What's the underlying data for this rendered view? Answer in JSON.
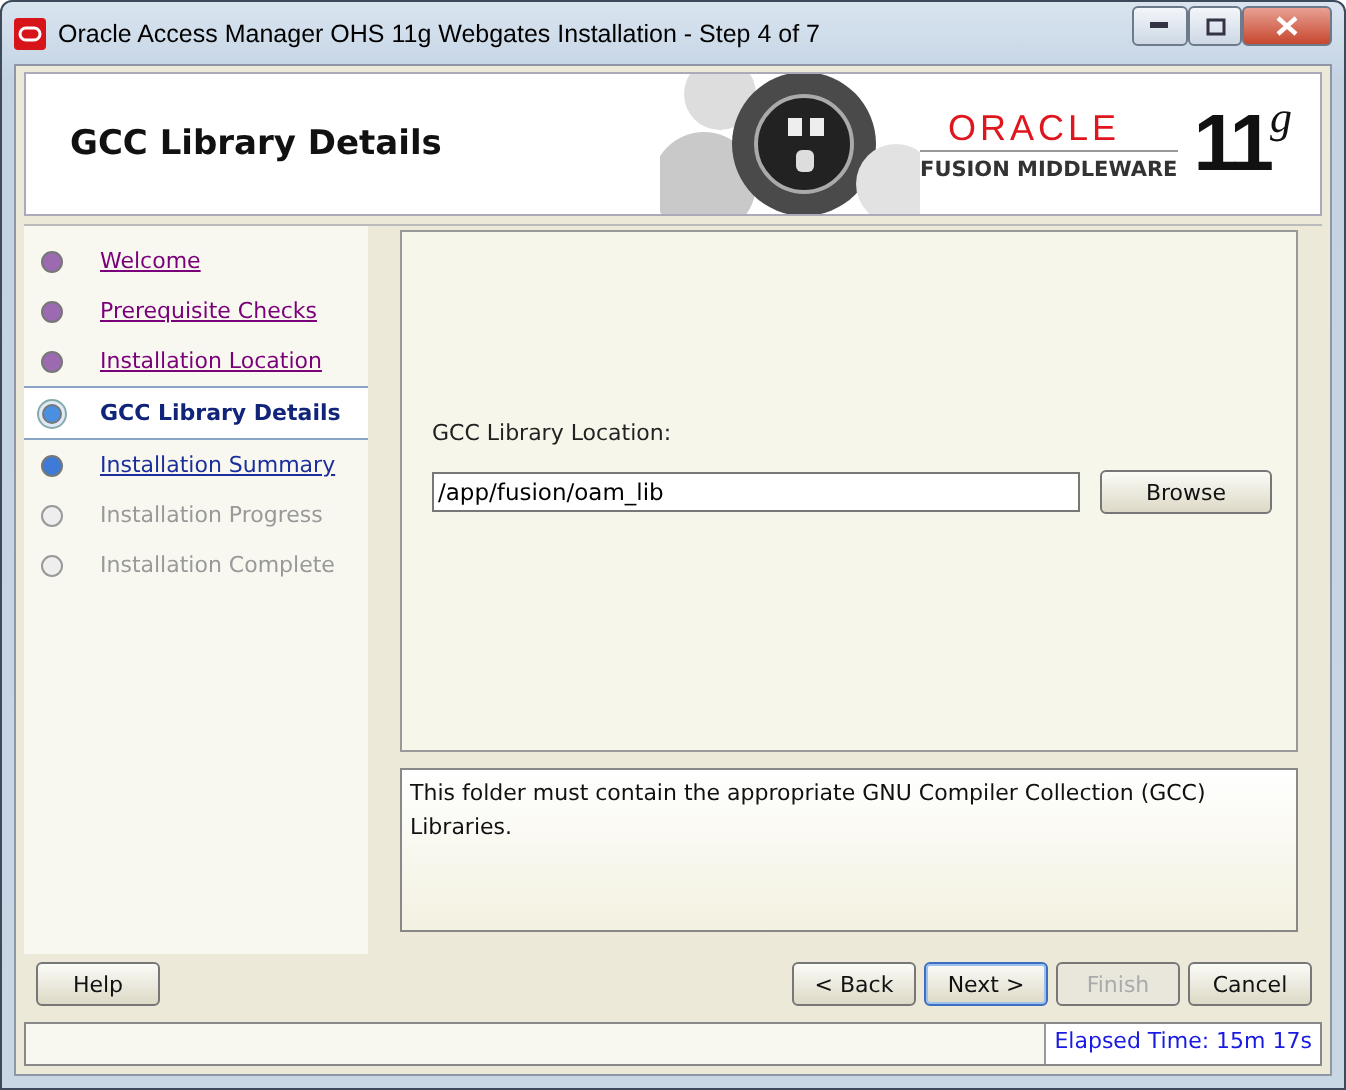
{
  "window": {
    "title": "Oracle Access Manager OHS 11g Webgates Installation - Step 4 of 7"
  },
  "header": {
    "title": "GCC Library Details",
    "brand": "ORACLE",
    "product": "FUSION MIDDLEWARE",
    "version": "11",
    "version_sup": "g"
  },
  "steps": [
    {
      "label": "Welcome",
      "completed": true,
      "disabled": false,
      "selected": false
    },
    {
      "label": "Prerequisite Checks",
      "completed": true,
      "disabled": false,
      "selected": false
    },
    {
      "label": "Installation Location",
      "completed": true,
      "disabled": false,
      "selected": false
    },
    {
      "label": "GCC Library Details",
      "completed": false,
      "disabled": false,
      "selected": true
    },
    {
      "label": "Installation Summary",
      "completed": false,
      "disabled": false,
      "selected": false
    },
    {
      "label": "Installation Progress",
      "completed": false,
      "disabled": true,
      "selected": false
    },
    {
      "label": "Installation Complete",
      "completed": false,
      "disabled": true,
      "selected": false
    }
  ],
  "form": {
    "label": "GCC Library Location:",
    "value": "/app/fusion/oam_lib",
    "browse": "Browse"
  },
  "message": "This folder must contain the appropriate GNU Compiler Collection (GCC) Libraries.",
  "buttons": [
    {
      "label": "Help",
      "disabled": false,
      "default": false
    },
    {
      "label": "< Back",
      "disabled": false,
      "default": false
    },
    {
      "label": "Next >",
      "disabled": false,
      "default": true
    },
    {
      "label": "Finish",
      "disabled": true,
      "default": false
    },
    {
      "label": "Cancel",
      "disabled": false,
      "default": false
    }
  ],
  "status_bar": {
    "elapsed": "Elapsed Time: 15m 17s"
  }
}
